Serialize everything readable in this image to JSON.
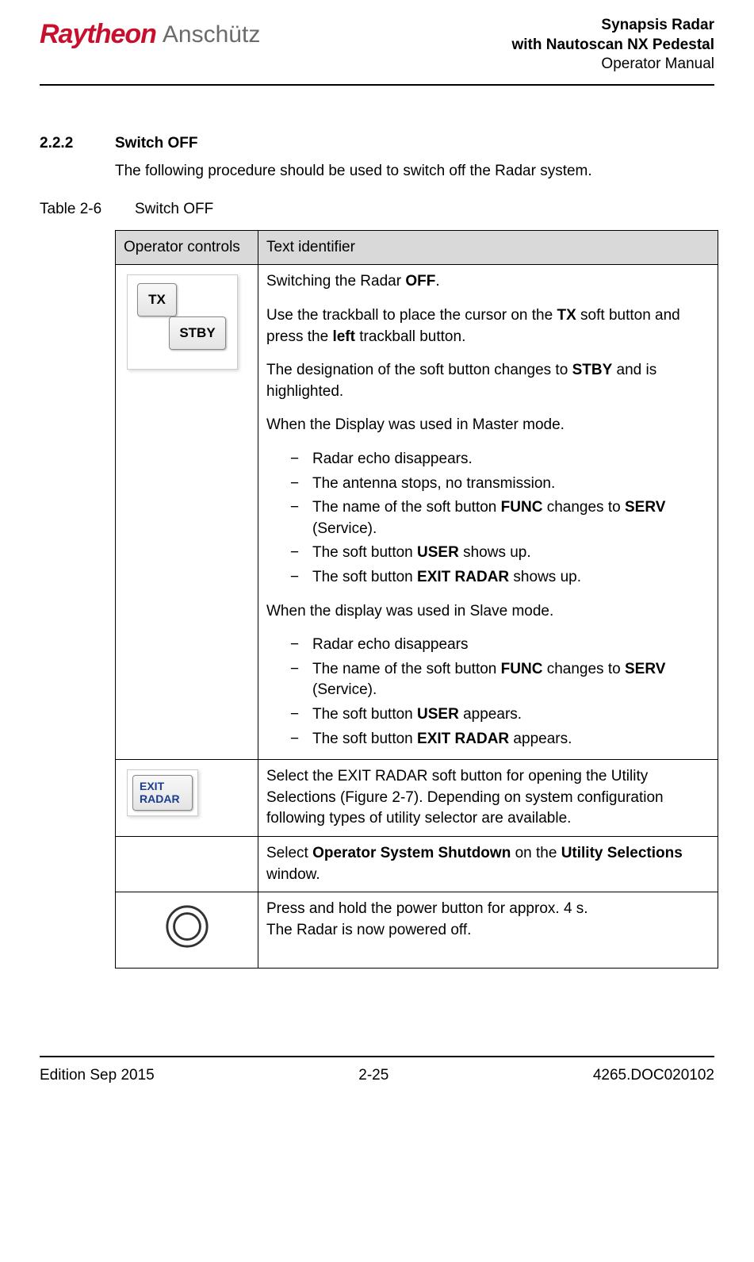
{
  "header": {
    "logo_raytheon": "Raytheon",
    "logo_anschutz": "Anschütz",
    "title_line1": "Synapsis Radar",
    "title_line2": "with Nautoscan NX Pedestal",
    "title_line3": "Operator Manual"
  },
  "section": {
    "number": "2.2.2",
    "title": "Switch OFF",
    "intro": "The following procedure should be used to switch off the Radar system."
  },
  "table_caption": {
    "num": "Table 2-6",
    "text": "Switch OFF"
  },
  "table": {
    "head_col1": "Operator controls",
    "head_col2": "Text identifier",
    "row1": {
      "btn_tx": "TX",
      "btn_stby": "STBY",
      "p1_a": "Switching the Radar ",
      "p1_b": "OFF",
      "p1_c": ".",
      "p2_a": "Use the trackball to place the cursor on the ",
      "p2_b": "TX",
      "p2_c": " soft button and press the ",
      "p2_d": "left",
      "p2_e": " trackball button.",
      "p3_a": "The designation of the soft button changes to ",
      "p3_b": "STBY",
      "p3_c": " and is highlighted.",
      "p4": "When the Display was used in Master mode.",
      "m1": "Radar echo disappears.",
      "m2": "The antenna stops, no transmission.",
      "m3_a": "The name of the soft button ",
      "m3_b": "FUNC",
      "m3_c": " changes to ",
      "m3_d": "SERV",
      "m3_e": " (Service).",
      "m4_a": "The soft button ",
      "m4_b": "USER",
      "m4_c": " shows up.",
      "m5_a": "The soft button ",
      "m5_b": "EXIT RADAR",
      "m5_c": " shows up.",
      "p5": "When the display was used in Slave mode.",
      "s1": "Radar echo disappears",
      "s2_a": "The name of the soft button ",
      "s2_b": "FUNC",
      "s2_c": " changes to ",
      "s2_d": "SERV",
      "s2_e": " (Service).",
      "s3_a": "The soft button ",
      "s3_b": "USER",
      "s3_c": " appears.",
      "s4_a": "The soft button ",
      "s4_b": "EXIT RADAR",
      "s4_c": " appears."
    },
    "row2": {
      "btn_exit_l1": "EXIT",
      "btn_exit_l2": "RADAR",
      "text": "Select the EXIT RADAR soft button for opening the Utility Selections (Figure 2-7). Depending on system configuration following types of utility selector are available."
    },
    "row3": {
      "a": "Select ",
      "b": "Operator System Shutdown",
      "c": " on the ",
      "d": "Utility Selections",
      "e": " window."
    },
    "row4": {
      "l1": "Press and hold the power button for approx. 4 s.",
      "l2": "The Radar is now powered off."
    }
  },
  "footer": {
    "left": "Edition Sep 2015",
    "center": "2-25",
    "right": "4265.DOC020102"
  }
}
